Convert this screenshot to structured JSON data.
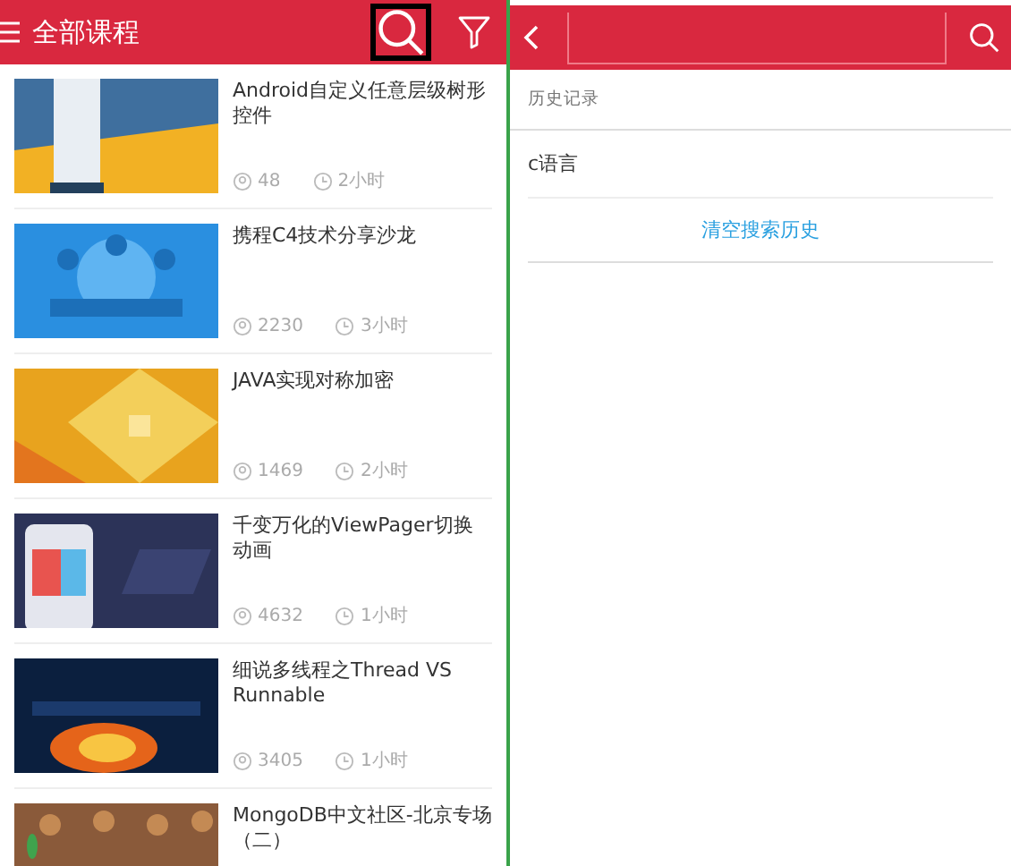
{
  "course_list": {
    "title": "全部课程",
    "courses": [
      {
        "title": "Android自定义任意层级树形控件",
        "learners": "48",
        "duration": "2小时",
        "kind": "picture"
      },
      {
        "title": "携程C4技术分享沙龙",
        "learners": "2230",
        "duration": "3小时",
        "kind": "picture"
      },
      {
        "title": "JAVA实现对称加密",
        "learners": "1469",
        "duration": "2小时",
        "kind": "picture"
      },
      {
        "title": "千变万化的ViewPager切换动画",
        "learners": "4632",
        "duration": "1小时",
        "kind": "picture"
      },
      {
        "title": "细说多线程之Thread VS Runnable",
        "learners": "3405",
        "duration": "1小时",
        "kind": "picture"
      },
      {
        "title": "MongoDB中文社区-北京专场（二）",
        "kind": "picture"
      }
    ]
  },
  "search_screen": {
    "history_label": "历史记录",
    "history": [
      "c语言"
    ],
    "clear_button": "清空搜索历史"
  }
}
